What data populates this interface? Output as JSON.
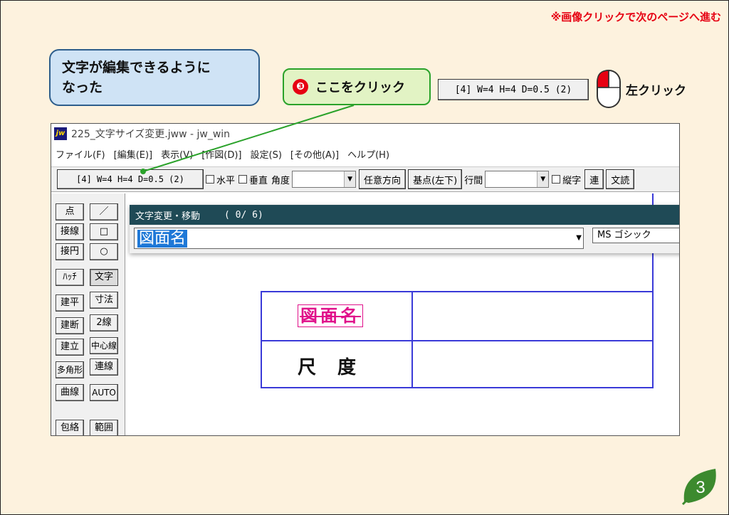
{
  "header": {
    "note": "※画像クリックで次のページへ進む"
  },
  "callout": {
    "line1": "文字が編集できるように",
    "line2": "なった"
  },
  "step": {
    "number": "❸",
    "label": "ここをクリック"
  },
  "reference": {
    "button": "[4] W=4 H=4 D=0.5 (2)",
    "mouse_action": "左クリック"
  },
  "window": {
    "title": "225_文字サイズ変更.jww - jw_win",
    "menu": [
      "ファイル(F)",
      "[編集(E)]",
      "表示(V)",
      "[作図(D)]",
      "設定(S)",
      "[その他(A)]",
      "ヘルプ(H)"
    ]
  },
  "toolbar": {
    "text_type_button": "[4] W=4 H=4 D=0.5 (2)",
    "horizontal": "水平",
    "vertical": "垂直",
    "angle_label": "角度",
    "arbitrary_direction": "任意方向",
    "base_point": "基点(左下)",
    "line_spacing": "行間",
    "vertical_text": "縦字",
    "continuous": "連",
    "read_text": "文読"
  },
  "tools": {
    "col1": [
      "点",
      "接線",
      "接円",
      "ﾊｯﾁ",
      "建平",
      "建断",
      "建立",
      "多角形",
      "曲線",
      "包絡"
    ],
    "col2": [
      "／",
      "□",
      "○",
      "文字",
      "寸法",
      "2線",
      "中心線",
      "連線",
      "AUTO",
      "範囲"
    ]
  },
  "dialog": {
    "title": "文字変更・移動",
    "counter": "( 0/  6)",
    "text_value": "図面名",
    "font": "MS ゴシック"
  },
  "drawing": {
    "title_text": "図面名",
    "scale_text": "尺度"
  },
  "page": {
    "number": "3"
  }
}
